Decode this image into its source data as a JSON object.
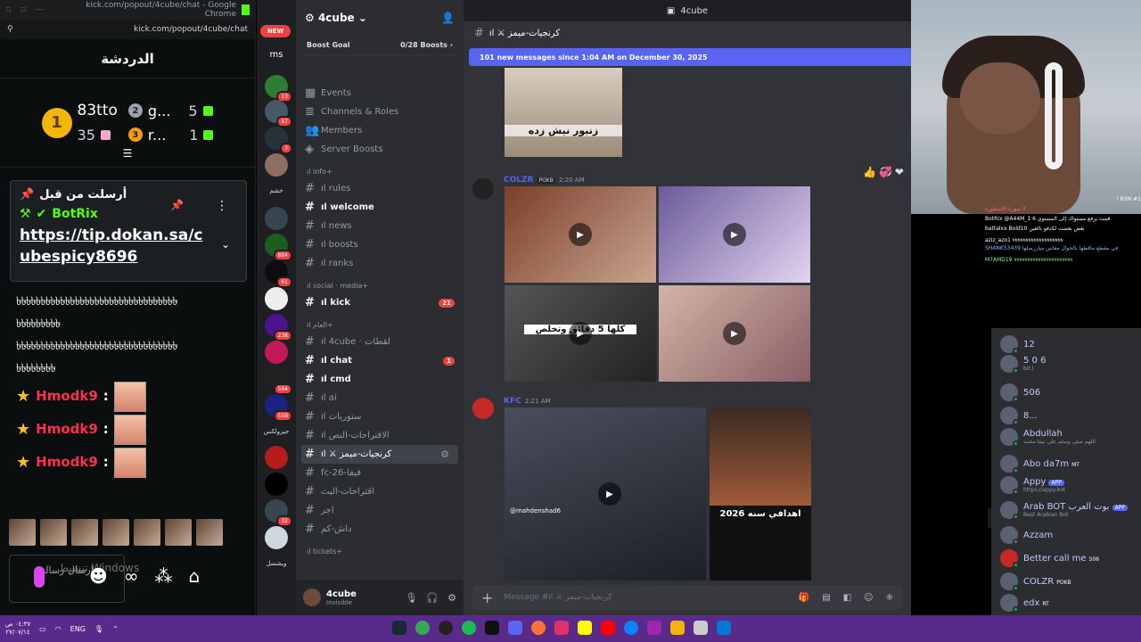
{
  "kick": {
    "window_title": "kick.com/popout/4cube/chat - Google Chrome",
    "url": "kick.com/popout/4cube/chat",
    "header": "الدردشة",
    "leaderboard": {
      "first": {
        "rank": "1",
        "name": "83tto"
      },
      "second": {
        "rank": "2",
        "name": "g...",
        "count": "5"
      },
      "third": {
        "rank": "3",
        "name": "r...",
        "count": "1"
      },
      "first_count": "35"
    },
    "pinned": {
      "title": "أرسلت من قبل",
      "user": "BotRix",
      "link": "https://tip.dokan.sa/cubespicy8696"
    },
    "messages": [
      "৳৳৳৳৳৳৳৳৳৳৳৳৳৳৳৳৳৳৳৳৳৳৳৳৳৳৳৳৳৳৳৳৳",
      "৳৳৳৳৳৳৳৳৳",
      "৳৳৳৳৳৳৳৳৳৳৳৳৳৳৳৳৳৳৳৳৳৳৳৳৳৳৳৳৳৳৳৳৳",
      "৳৳৳৳৳৳৳৳৳৳৳৳৳৳৳৳৳৳৳৳৳৳৳৳৳৳৳৳৳৳৳৳৳",
      "৳৳৳৳৳৳৳৳"
    ],
    "emote_user": "Hmodk9",
    "input_placeholder": "إرسال رسالة",
    "watermark": "تنشيط Windows"
  },
  "discord": {
    "new_badge": "NEW",
    "ms_label": "ms",
    "server_badges": [
      "13",
      "57",
      "3",
      "884",
      "61",
      "238",
      "594",
      "559",
      "32"
    ],
    "server_labels": [
      "خشم",
      "جيرولكس",
      "ويشسل"
    ],
    "guild": "4cube",
    "boost_goal": "Boost Goal",
    "boost_count": "0/28 Boosts",
    "menu": [
      "Events",
      "Channels & Roles",
      "Members",
      "Server Boosts"
    ],
    "categories": {
      "info": "ıl info",
      "social": "ıl social · media",
      "general": "ıl العام",
      "tickets": "ıl tickets"
    },
    "channels": {
      "rules": "ıl rules",
      "welcome": "ıl welcome",
      "news": "ıl news",
      "boosts": "ıl boosts",
      "ranks": "ıl ranks",
      "kick": "ıl kick",
      "kick_badge": "21",
      "cube": "ıl 4cube · لقطات",
      "chat": "ıl chat",
      "chat_badge": "1",
      "cmd": "ıl cmd",
      "ai": "ıl ai",
      "stories": "ıl ستوريات",
      "suggest": "ıl الاقتراحات-النص",
      "memes": "ıl ⚔ كرنجيات-ميمز",
      "fc": "fc-26-فيفا",
      "suggest2": "اقتراحات-البث",
      "ajr": "اجر",
      "dash": "داش-كم"
    },
    "user": {
      "name": "4cube",
      "status": "Invisible"
    },
    "window_title": "4cube",
    "channel_header": "ıl ⚔ كرنجيات-ميمز",
    "new_messages": "101 new messages since 1:04 AM on December 30, 2025",
    "caption_top": "زنبور نيش زده",
    "msg1": {
      "author": "COLZR",
      "tag": "POKB",
      "time": "2:20 AM",
      "caption": "كلها 5 دقائق وتخلص"
    },
    "msg2": {
      "author": "KFC",
      "time": "2:21 AM",
      "caption": "اهدافي سنه 2026",
      "tiktok_user": "@mahdenshad6"
    },
    "composer_placeholder": "Message #ıl ⚔ كرنجيات-ميمز"
  },
  "overlay": [
    {
      "name": "RXN",
      "text": "! RXN #1"
    },
    {
      "name": "A44M_1",
      "text": "لا صورة الاسطورة"
    },
    {
      "name": "BotRix",
      "text": "BotRix @A44M_1 6 قمت برفع مستواك إلى المستوى"
    },
    {
      "name": "battalxx",
      "text": "battalxx Bold10 بغض بغضت لكدفو بالعين"
    },
    {
      "name": "aziz_azo1",
      "text": "aziz_azo1 ৳৳৳৳৳৳৳৳৳৳৳৳৳৳৳৳৳৳৳"
    },
    {
      "name": "SHANKS3439",
      "text": "SHANKS3439 في مقطع ماقطها بالجوال مقاس ميازرصلها"
    },
    {
      "name": "M7AMD19",
      "text": "M7AMD19 ৳৳৳৳৳৳৳৳৳৳৳৳৳৳৳৳৳৳৳৳৳৳"
    }
  ],
  "members": [
    {
      "name": "12",
      "sub": ""
    },
    {
      "name": "5 0 6",
      "sub": "bit.l"
    },
    {
      "name": "506",
      "sub": ""
    },
    {
      "name": "8...",
      "sub": ""
    },
    {
      "name": "Abdullah",
      "sub": "اللهم صلي وسلم على نبينا محمد"
    },
    {
      "name": "Abo da7m",
      "sub": "",
      "badge": "MT"
    },
    {
      "name": "Appy",
      "sub": "https://appy.bot",
      "badge": "APP"
    },
    {
      "name": "Arab BOT بوت العرب",
      "sub": "Best Arabian Bot",
      "badge": "APP"
    },
    {
      "name": "Azzam",
      "sub": ""
    },
    {
      "name": "Better call me",
      "sub": "",
      "badge": "506"
    },
    {
      "name": "COLZR",
      "sub": "",
      "badge": "POKB"
    },
    {
      "name": "edx",
      "sub": "",
      "badge": "RT"
    }
  ],
  "taskbar": {
    "time": "٠٤:٣٧ ص",
    "date": "٢٧/٠٧/١٤",
    "lang": "ENG"
  },
  "colors": {
    "kick_green": "#53fc18",
    "discord_blurple": "#5865f2",
    "taskbar": "#5a2a8a",
    "unread_red": "#f23f42"
  }
}
